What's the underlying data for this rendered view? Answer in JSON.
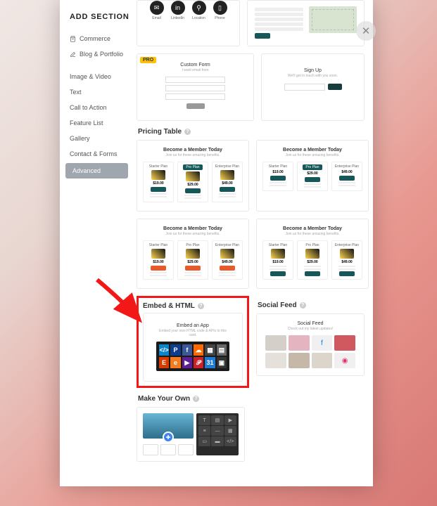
{
  "header": {
    "title": "ADD SECTION"
  },
  "nav": {
    "commerce": "Commerce",
    "blog": "Blog & Portfolio",
    "image": "Image & Video",
    "text": "Text",
    "cta": "Call to Action",
    "features": "Feature List",
    "gallery": "Gallery",
    "contact": "Contact & Forms",
    "advanced": "Advanced"
  },
  "badges": {
    "pro": "PRO"
  },
  "categories": {
    "pricing": "Pricing Table",
    "embed": "Embed & HTML",
    "social_feed": "Social Feed",
    "myo": "Make Your Own"
  },
  "social_icons": {
    "items": [
      {
        "name": "Email"
      },
      {
        "name": "LinkedIn"
      },
      {
        "name": "Location"
      },
      {
        "name": "Phone"
      }
    ]
  },
  "custom_form": {
    "title": "Custom Form",
    "subtitle": "I want email from"
  },
  "signup": {
    "title": "Sign Up",
    "subtitle": "We'll get in touch with you soon."
  },
  "pricing_card": {
    "title": "Become a Member Today",
    "subtitle": "Join us for these amazing benefits.",
    "plans": [
      {
        "name": "Starter Plan",
        "price": "$19.00"
      },
      {
        "name": "Pro Plan",
        "price": "$29.00"
      },
      {
        "name": "Enterprise Plan",
        "price": "$49.00"
      }
    ]
  },
  "embed": {
    "title": "Embed an App",
    "subtitle": "Embed your own HTML code & APIs to this card."
  },
  "feed": {
    "title": "Social Feed",
    "subtitle": "Check out my latest updates!"
  },
  "colors": {
    "accent": "#16575a",
    "highlight": "#f21818",
    "pro": "#ffc107"
  }
}
